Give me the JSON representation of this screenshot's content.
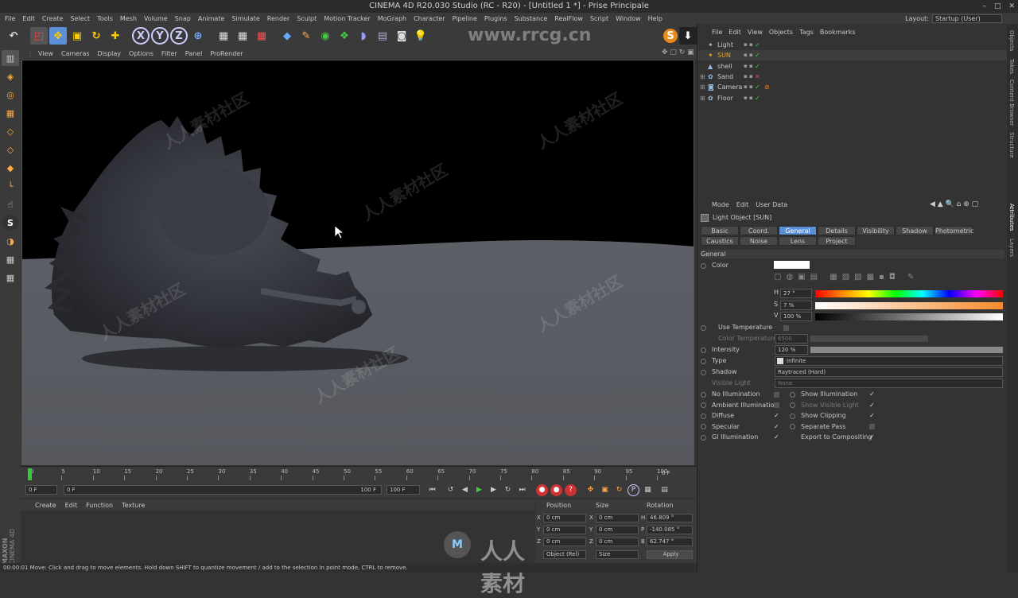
{
  "app": {
    "title": "CINEMA 4D R20.030 Studio (RC - R20) - [Untitled 1 *] - Prise Principale",
    "window_controls": [
      "–",
      "□",
      "✕"
    ]
  },
  "menu": [
    "File",
    "Edit",
    "Create",
    "Select",
    "Tools",
    "Mesh",
    "Volume",
    "Snap",
    "Animate",
    "Simulate",
    "Render",
    "Sculpt",
    "Motion Tracker",
    "MoGraph",
    "Character",
    "Pipeline",
    "Plugins",
    "Substance",
    "RealFlow",
    "Script",
    "Window",
    "Help"
  ],
  "layout": {
    "label": "Layout:",
    "value": "Startup (User)"
  },
  "toolbar_icons": [
    "undo-icon",
    "live-select-icon",
    "move-icon",
    "scale-icon",
    "rotate-icon",
    "add-icon",
    "x-axis-icon",
    "y-axis-icon",
    "z-axis-icon",
    "world-coord-icon",
    "render-view-icon",
    "render-picture-icon",
    "render-settings-icon",
    "cube-icon",
    "pen-icon",
    "subdivision-icon",
    "cloner-icon",
    "deformer-icon",
    "floor-icon",
    "camera-icon",
    "light-icon"
  ],
  "axis_letters": {
    "x": "X",
    "y": "Y",
    "z": "Z"
  },
  "viewport_menu": [
    "View",
    "Cameras",
    "Display",
    "Options",
    "Filter",
    "Panel",
    "ProRender"
  ],
  "timeline": {
    "ticks": [
      "0",
      "5",
      "10",
      "15",
      "20",
      "25",
      "30",
      "35",
      "40",
      "45",
      "50",
      "55",
      "60",
      "65",
      "70",
      "75",
      "80",
      "85",
      "90",
      "95",
      "100"
    ],
    "end_label": "0 F",
    "current_frame": "0 F",
    "start_field": "0 F",
    "end_field": "100 F",
    "max_field": "100 F"
  },
  "material_menu": [
    "Create",
    "Edit",
    "Function",
    "Texture"
  ],
  "coords": {
    "headers": [
      "Position",
      "Size",
      "Rotation"
    ],
    "rows": [
      {
        "axis": "X",
        "pos": "0 cm",
        "size_axis": "X",
        "size": "0 cm",
        "rot_axis": "H",
        "rot": "46.809 °"
      },
      {
        "axis": "Y",
        "pos": "0 cm",
        "size_axis": "Y",
        "size": "0 cm",
        "rot_axis": "P",
        "rot": "-140.085 °"
      },
      {
        "axis": "Z",
        "pos": "0 cm",
        "size_axis": "Z",
        "size": "0 cm",
        "rot_axis": "B",
        "rot": "62.747 °"
      }
    ],
    "mode": "Object (Rel)",
    "size_mode": "Size",
    "apply": "Apply"
  },
  "status": "00:00:01   Move: Click and drag to move elements. Hold down SHIFT to quantize movement / add to the selection in point mode, CTRL to remove.",
  "object_manager": {
    "menu": [
      "File",
      "Edit",
      "View",
      "Objects",
      "Tags",
      "Bookmarks"
    ],
    "objects": [
      {
        "name": "Light",
        "icon": "light-icon",
        "color": "#c8c8c8"
      },
      {
        "name": "SUN",
        "icon": "sun-icon",
        "color": "#f0a020"
      },
      {
        "name": "shell",
        "icon": "mesh-icon",
        "color": "#c8c8c8"
      },
      {
        "name": "Sand",
        "icon": "plane-icon",
        "color": "#c8c8c8"
      },
      {
        "name": "Camera",
        "icon": "camera-icon",
        "color": "#c8c8c8"
      },
      {
        "name": "Floor",
        "icon": "floor-icon",
        "color": "#c8c8c8"
      }
    ]
  },
  "attributes": {
    "menu": [
      "Mode",
      "Edit",
      "User Data"
    ],
    "object_title": "Light Object [SUN]",
    "tabs_row1": [
      "Basic",
      "Coord.",
      "General",
      "Details",
      "Visibility",
      "Shadow",
      "Photometric"
    ],
    "tabs_row2": [
      "Caustics",
      "Noise",
      "Lens",
      "Project"
    ],
    "active_tab": "General",
    "section": "General",
    "color_label": "Color",
    "hsv": [
      {
        "label": "H",
        "value": "27 °"
      },
      {
        "label": "S",
        "value": "7 %"
      },
      {
        "label": "V",
        "value": "100 %"
      }
    ],
    "use_temperature": "Use Temperature",
    "color_temperature": "Color Temperature",
    "color_temperature_value": "6500",
    "intensity": {
      "label": "Intensity",
      "value": "120 %",
      "level": 1.0
    },
    "type": {
      "label": "Type",
      "value": "Infinite"
    },
    "shadow": {
      "label": "Shadow",
      "value": "Raytraced (Hard)"
    },
    "visible_light": {
      "label": "Visible Light",
      "value": "None"
    },
    "checks_left": [
      {
        "label": "No Illumination",
        "checked": false
      },
      {
        "label": "Ambient Illumination",
        "checked": false
      },
      {
        "label": "Diffuse",
        "checked": true
      },
      {
        "label": "Specular",
        "checked": true
      },
      {
        "label": "GI Illumination",
        "checked": true
      }
    ],
    "checks_right": [
      {
        "label": "Show Illumination",
        "checked": true
      },
      {
        "label": "Show Visible Light",
        "checked": true
      },
      {
        "label": "Show Clipping",
        "checked": true
      },
      {
        "label": "Separate Pass",
        "checked": false
      },
      {
        "label": "Export to Compositing",
        "checked": true
      }
    ]
  },
  "side_tabs": [
    "Objects",
    "Takes",
    "Content Browser",
    "Structure",
    "Attributes",
    "Layers"
  ],
  "brand": {
    "maxon": "MAXON",
    "c4d": "CINEMA 4D"
  },
  "watermark": {
    "top": "www.rrcg.cn",
    "bottom": "人人素材"
  },
  "colors": {
    "accent": "#5b8fd8",
    "sun_orange": "#f0a020",
    "viewport_sky": "#000000",
    "sand": "#5a5d63"
  }
}
